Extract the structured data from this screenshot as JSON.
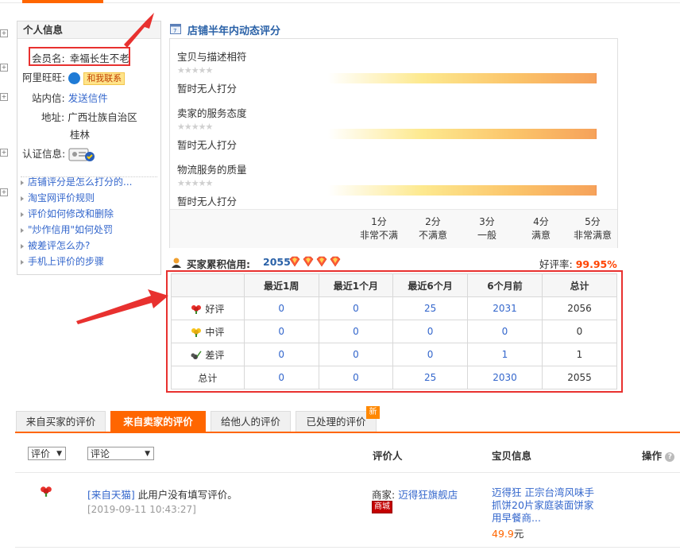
{
  "profile": {
    "title": "个人信息",
    "member_label": "会员名:",
    "member_name": "幸福长生不老",
    "wangwang_label": "阿里旺旺:",
    "wangwang_button": "和我联系",
    "message_label": "站内信:",
    "message_link": "发送信件",
    "address_label": "地址:",
    "address_line1": "广西壮族自治区",
    "address_line2": "桂林",
    "cert_label": "认证信息:"
  },
  "help_links": [
    "店铺评分是怎么打分的...",
    "淘宝网评价规则",
    "评价如何修改和删除",
    "\"炒作信用\"如何处罚",
    "被差评怎么办?",
    "手机上评价的步骤"
  ],
  "shop_rating": {
    "title": "店铺半年内动态评分",
    "items": [
      {
        "label": "宝贝与描述相符",
        "stars": "★★★★★",
        "status": "暂时无人打分"
      },
      {
        "label": "卖家的服务态度",
        "stars": "★★★★★",
        "status": "暂时无人打分"
      },
      {
        "label": "物流服务的质量",
        "stars": "★★★★★",
        "status": "暂时无人打分"
      }
    ],
    "scale": [
      {
        "score": "1分",
        "desc": "非常不满"
      },
      {
        "score": "2分",
        "desc": "不满意"
      },
      {
        "score": "3分",
        "desc": "一般"
      },
      {
        "score": "4分",
        "desc": "满意"
      },
      {
        "score": "5分",
        "desc": "非常满意"
      }
    ]
  },
  "buyer_credit": {
    "label": "买家累积信用:",
    "score": "2055",
    "good_rate_label": "好评率:",
    "good_rate": "99.95%",
    "headers": [
      "",
      "最近1周",
      "最近1个月",
      "最近6个月",
      "6个月前",
      "总计"
    ],
    "rows": [
      {
        "label": "好评",
        "icon": "red-flower-icon",
        "values": [
          "0",
          "0",
          "25",
          "2031",
          "2056"
        ]
      },
      {
        "label": "中评",
        "icon": "yellow-flower-icon",
        "values": [
          "0",
          "0",
          "0",
          "0",
          "0"
        ]
      },
      {
        "label": "差评",
        "icon": "wilted-flower-icon",
        "values": [
          "0",
          "0",
          "0",
          "1",
          "1"
        ]
      },
      {
        "label": "总计",
        "icon": "",
        "values": [
          "0",
          "0",
          "25",
          "2030",
          "2055"
        ]
      }
    ]
  },
  "tabs": [
    {
      "label": "来自买家的评价",
      "active": false
    },
    {
      "label": "来自卖家的评价",
      "active": true
    },
    {
      "label": "给他人的评价",
      "active": false
    },
    {
      "label": "已处理的评价",
      "active": false
    }
  ],
  "new_badge": "新",
  "filters": {
    "rating_select": "评价",
    "comment_select": "评论"
  },
  "columns": {
    "reviewer": "评价人",
    "item": "宝贝信息",
    "action": "操作"
  },
  "review": {
    "source": "[来自天猫]",
    "text": "此用户没有填写评价。",
    "date": "[2019-09-11 10:43:27]",
    "seller_label": "商家:",
    "seller_name": "迈得狂旗舰店",
    "mall_badge": "商城",
    "item_title": "迈得狂 正宗台湾风味手抓饼20片家庭装面饼家用早餐商...",
    "price": "49.9",
    "price_unit": "元"
  },
  "colors": {
    "accent": "#ff6600",
    "link": "#3366cc",
    "annotation_red": "#e8312f"
  }
}
